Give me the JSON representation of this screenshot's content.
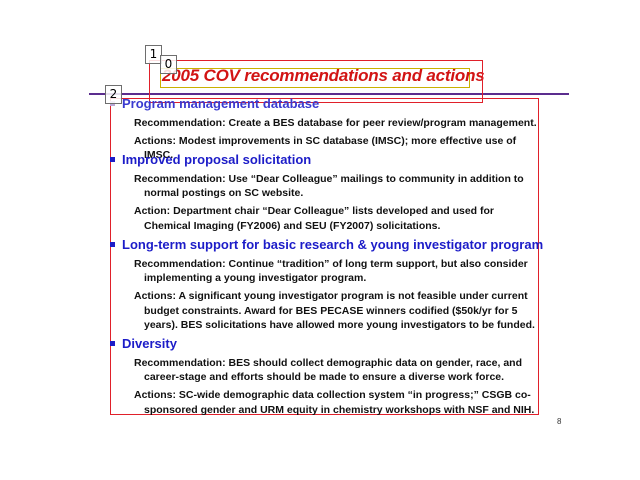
{
  "slide": {
    "title": "2005 COV recommendations and actions",
    "page_number": "8"
  },
  "markers": [
    "1",
    "0",
    "2"
  ],
  "sections": [
    {
      "heading": "Program management database",
      "items": [
        "Recommendation:  Create a BES database for peer review/program management.",
        "Actions:  Modest improvements in SC database (IMSC); more effective use of IMSC."
      ]
    },
    {
      "heading": "Improved proposal solicitation",
      "items": [
        "Recommendation:  Use “Dear Colleague” mailings to community in addition to normal postings on SC website.",
        "Action:  Department chair “Dear Colleague” lists developed and used for Chemical Imaging (FY2006) and SEU (FY2007) solicitations."
      ]
    },
    {
      "heading": "Long-term support for basic research & young investigator program",
      "items": [
        "Recommendation:  Continue “tradition” of long term support, but also consider implementing a young investigator program.",
        "Actions:  A significant young investigator program is not feasible under current budget constraints.  Award for BES PECASE winners codified ($50k/yr for 5 years). BES solicitations have allowed more young investigators to be funded."
      ]
    },
    {
      "heading": "Diversity",
      "items": [
        "Recommendation:  BES should collect demographic data on gender, race, and career-stage and efforts should be made to ensure a diverse work force.",
        "Actions:  SC-wide demographic data collection system “in progress;” CSGB co-sponsored gender and URM equity in chemistry workshops with NSF and NIH."
      ]
    }
  ]
}
